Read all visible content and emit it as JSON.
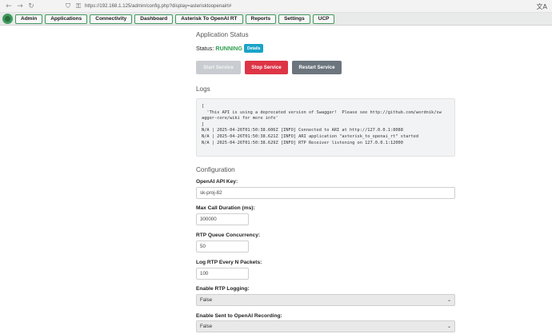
{
  "browser": {
    "back_icon": "arrow-left-icon",
    "forward_icon": "arrow-right-icon",
    "reload_icon": "reload-icon",
    "url": "https://192.168.1.125/admin/config.php?display=asterisktoopenairt#"
  },
  "menu": {
    "items": [
      "Admin",
      "Applications",
      "Connectivity",
      "Dashboard",
      "Asterisk To OpenAI RT",
      "Reports",
      "Settings",
      "UCP"
    ]
  },
  "status": {
    "heading": "Application Status",
    "label": "Status:",
    "value": "RUNNING",
    "details_label": "Details",
    "start_label": "Start Service",
    "stop_label": "Stop Service",
    "restart_label": "Restart Service"
  },
  "logs": {
    "heading": "Logs",
    "text": "[\n  'This API is using a deprecated version of Swagger!  Please see http://github.com/wordnik/sw\nagger-core/wiki for more info'\n]\nN/A | 2025-04-26T01:50:38.606Z [INFO] Connected to ARI at http://127.0.0.1:8088\nN/A | 2025-04-26T01:50:38.621Z [INFO] ARI application \"asterisk_to_openai_rt\" started\nN/A | 2025-04-26T01:50:38.629Z [INFO] RTP Receiver listening on 127.0.0.1:12000"
  },
  "config": {
    "heading": "Configuration",
    "api_key_label": "OpenAI API Key:",
    "api_key_value": "sk-proj-82",
    "max_call_label": "Max Call Duration (ms):",
    "max_call_value": "300000",
    "rtp_queue_label": "RTP Queue Concurrency:",
    "rtp_queue_value": "50",
    "log_rtp_label": "Log RTP Every N Packets:",
    "log_rtp_value": "100",
    "enable_rtp_label": "Enable RTP Logging:",
    "enable_rtp_value": "False",
    "enable_sent_label": "Enable Sent to OpenAI Recording:",
    "enable_sent_value": "False"
  }
}
